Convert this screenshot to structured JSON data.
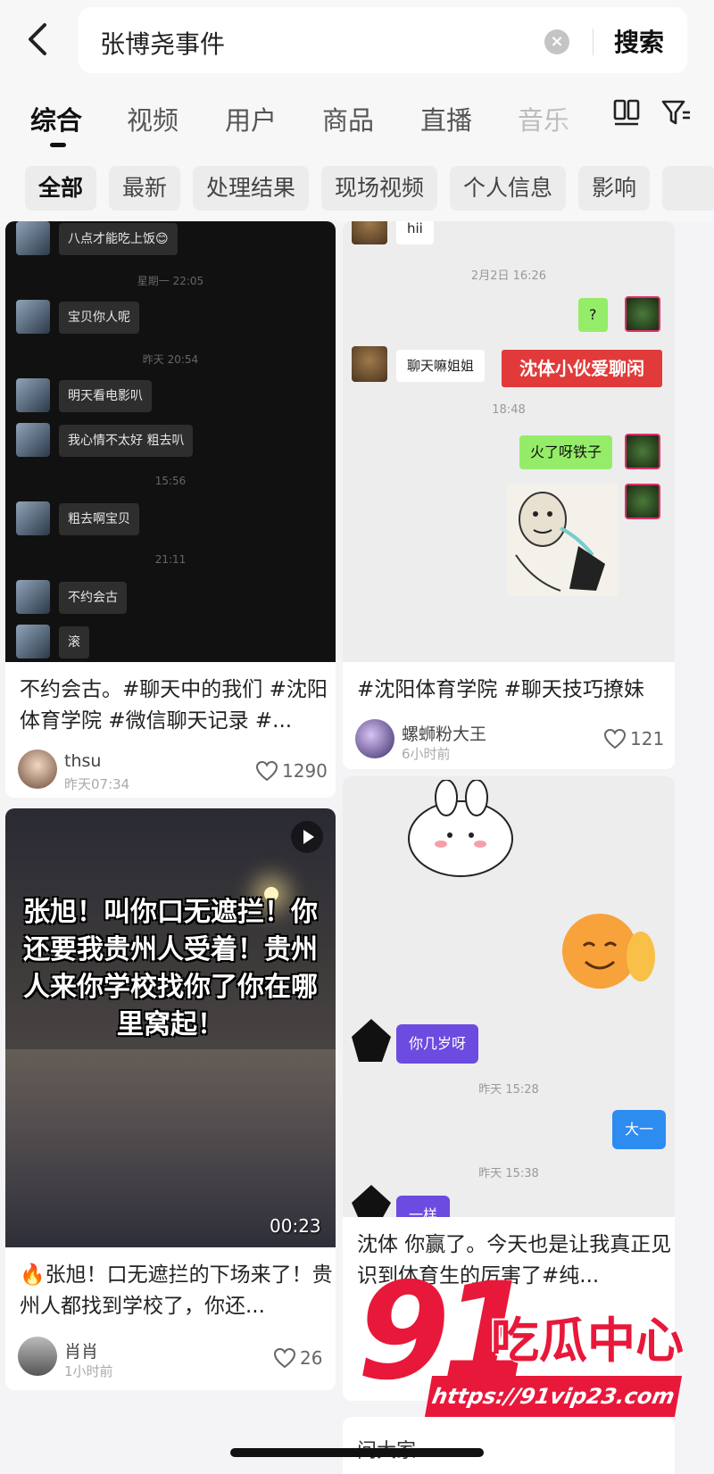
{
  "search": {
    "query": "张博尧事件",
    "button_label": "搜索"
  },
  "tabs": [
    {
      "label": "综合",
      "active": true
    },
    {
      "label": "视频",
      "active": false
    },
    {
      "label": "用户",
      "active": false
    },
    {
      "label": "商品",
      "active": false
    },
    {
      "label": "直播",
      "active": false
    },
    {
      "label": "音乐",
      "active": false
    }
  ],
  "chips": [
    {
      "label": "全部",
      "active": true
    },
    {
      "label": "最新",
      "active": false
    },
    {
      "label": "处理结果",
      "active": false
    },
    {
      "label": "现场视频",
      "active": false
    },
    {
      "label": "个人信息",
      "active": false
    },
    {
      "label": "影响",
      "active": false
    }
  ],
  "icons": {
    "back": "chevron-left-icon",
    "clear": "clear-icon",
    "layout": "layout-toggle-icon",
    "filter": "filter-icon",
    "like": "heart-icon",
    "play": "play-icon"
  },
  "cards": [
    {
      "title": "不约会古。#聊天中的我们 #沈阳体育学院 #微信聊天记录 #...",
      "author": "thsu",
      "time": "昨天07:34",
      "likes": "1290",
      "thumb": {
        "messages": [
          {
            "text": "八点才能吃上饭😊"
          },
          {
            "time": "星期一 22:05"
          },
          {
            "text": "宝贝你人呢"
          },
          {
            "time": "昨天 20:54"
          },
          {
            "text": "明天看电影叭"
          },
          {
            "text": "我心情不太好 粗去叭"
          },
          {
            "time": "15:56"
          },
          {
            "text": "粗去啊宝贝"
          },
          {
            "time": "21:11"
          },
          {
            "text": "不约会古"
          },
          {
            "text": "滚"
          }
        ]
      }
    },
    {
      "title": "#沈阳体育学院 #聊天技巧撩妹",
      "author": "螺蛳粉大王",
      "time": "6小时前",
      "likes": "121",
      "thumb": {
        "msg_hii": "hii",
        "time1": "2月2日 16:26",
        "msg_q": "?",
        "msg_chat": "聊天嘛姐姐",
        "banner": "沈体小伙爱聊闲",
        "time2": "18:48",
        "msg_fire": "火了呀铁子"
      }
    },
    {
      "title": "🔥张旭！口无遮拦的下场来了！贵州人都找到学校了，你还...",
      "author": "肖肖",
      "time": "1小时前",
      "likes": "26",
      "thumb": {
        "overlay_text": "张旭！叫你口无遮拦！你还要我贵州人受着！贵州人来你学校找你了你在哪里窝起！",
        "duration": "00:23"
      }
    },
    {
      "title": "沈体 你赢了。今天也是让我真正见识到体育生的厉害了#纯...",
      "thumb": {
        "msg_age": "你几岁呀",
        "time1": "昨天 15:28",
        "msg_year": "大一",
        "time2": "昨天 15:38",
        "msg_same": "一样"
      }
    }
  ],
  "bottom_card": {
    "text": "问大家"
  },
  "watermark": {
    "number": "91",
    "brand": "吃瓜中心",
    "url": "https://91vip23.com"
  }
}
